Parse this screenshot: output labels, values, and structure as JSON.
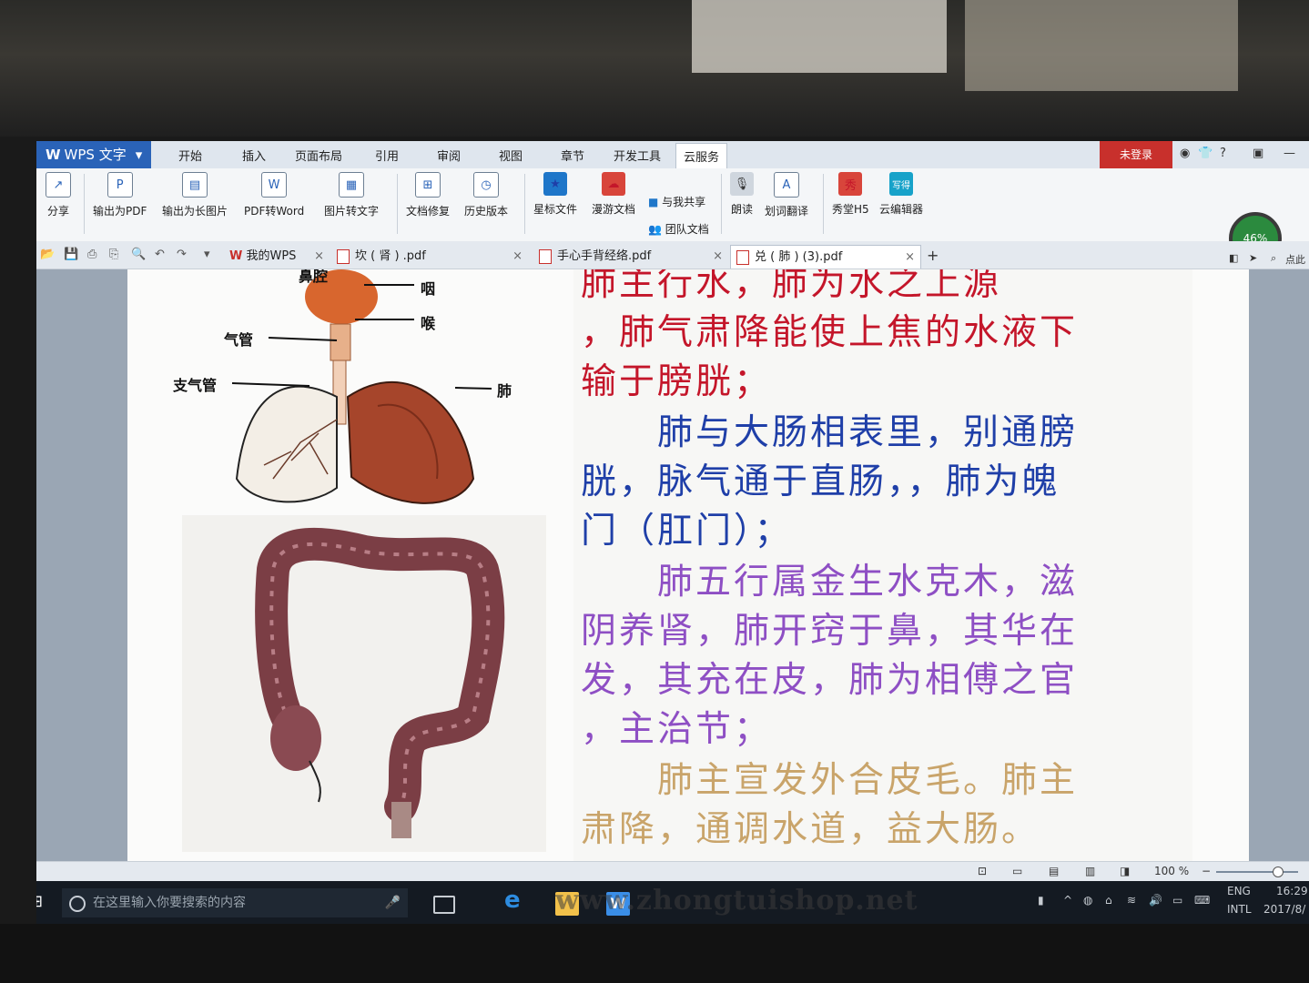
{
  "app": {
    "name": "WPS 文字"
  },
  "menu": {
    "tabs": [
      "开始",
      "插入",
      "页面布局",
      "引用",
      "审阅",
      "视图",
      "章节",
      "开发工具",
      "云服务"
    ],
    "active": "云服务",
    "login": "未登录"
  },
  "ribbon": {
    "buttons": [
      "分享",
      "输出为PDF",
      "输出为长图片",
      "PDF转Word",
      "图片转文字",
      "文档修复",
      "历史版本",
      "星标文件",
      "漫游文档",
      "团队文档",
      "与我共享",
      "朗读",
      "划词翻译",
      "秀堂H5",
      "云编辑器"
    ],
    "icon_glyphs": {
      "xiu": "秀",
      "xiuge": "写得"
    },
    "gauge": "46%"
  },
  "tabs": {
    "home": "我的WPS",
    "docs": [
      "坎 ( 肾 ) .pdf",
      "手心手背经络.pdf",
      "兑 ( 肺 ) (3).pdf"
    ],
    "right_label": "点此"
  },
  "figure": {
    "labels": [
      "鼻腔",
      "咽",
      "喉",
      "气管",
      "支气管",
      "肺"
    ]
  },
  "document": {
    "lines": [
      "肺主行水，肺为水之上源",
      "，肺气肃降能使上焦的水液下",
      "输于膀胱；",
      "　　肺与大肠相表里，别通膀",
      "胱，脉气通于直肠，，肺为魄",
      "门（肛门）；",
      "　　肺五行属金生水克木，滋",
      "阴养肾，肺开窍于鼻，其华在",
      "发，其充在皮，肺为相傅之官",
      "，主治节；",
      "　　肺主宣发外合皮毛。肺主",
      "肃降，通调水道，益大肠。"
    ],
    "colors": {
      "red": "#c4162a",
      "blue": "#1f3fa8",
      "purple": "#8e4fc4",
      "gold": "#c9a46a"
    }
  },
  "status": {
    "zoom": "100 %"
  },
  "taskbar": {
    "search_placeholder": "在这里输入你要搜索的内容",
    "lang": "ENG",
    "layout": "INTL",
    "time": "16:29",
    "date": "2017/8/",
    "watermark": "www.zhongtuishop.net"
  }
}
